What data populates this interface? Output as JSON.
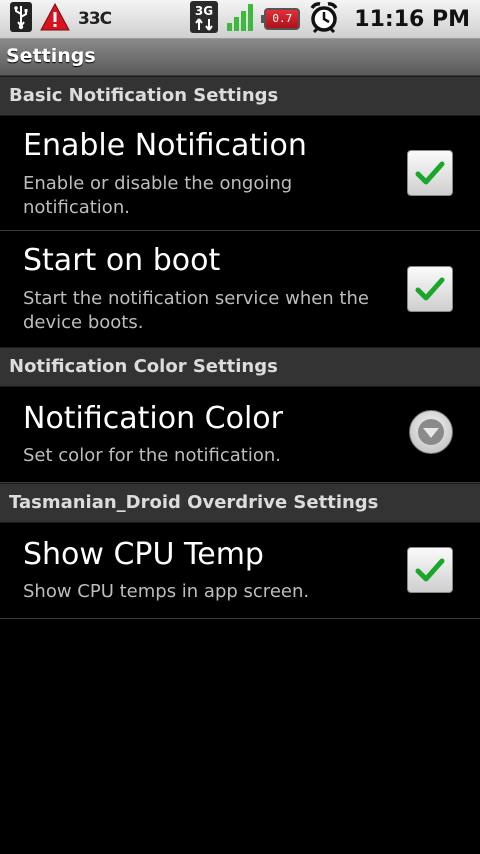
{
  "status_bar": {
    "temperature": "33C",
    "network_type": "3G",
    "battery_label": "0.7",
    "time": "11:16 PM",
    "icons": [
      "usb-icon",
      "warning-icon",
      "3g-icon",
      "signal-icon",
      "battery-icon",
      "alarm-icon"
    ]
  },
  "title_bar": {
    "title": "Settings"
  },
  "categories": [
    {
      "label": "Basic Notification Settings"
    },
    {
      "label": "Notification Color Settings"
    },
    {
      "label": "Tasmanian_Droid Overdrive Settings"
    }
  ],
  "preferences": [
    {
      "title": "Enable Notification",
      "summary": "Enable or disable the ongoing notification.",
      "checked": true,
      "widget": "checkbox"
    },
    {
      "title": "Start on boot",
      "summary": "Start the notification service when the device boots.",
      "checked": true,
      "widget": "checkbox"
    },
    {
      "title": "Notification Color",
      "summary": "Set color for the notification.",
      "widget": "dropdown"
    },
    {
      "title": "Show CPU Temp",
      "summary": "Show CPU temps in app screen.",
      "checked": true,
      "widget": "checkbox"
    }
  ],
  "colors": {
    "check_green": "#1aa62a",
    "category_bg": "#333333",
    "titlebar_bg": "#6e6e6e"
  }
}
